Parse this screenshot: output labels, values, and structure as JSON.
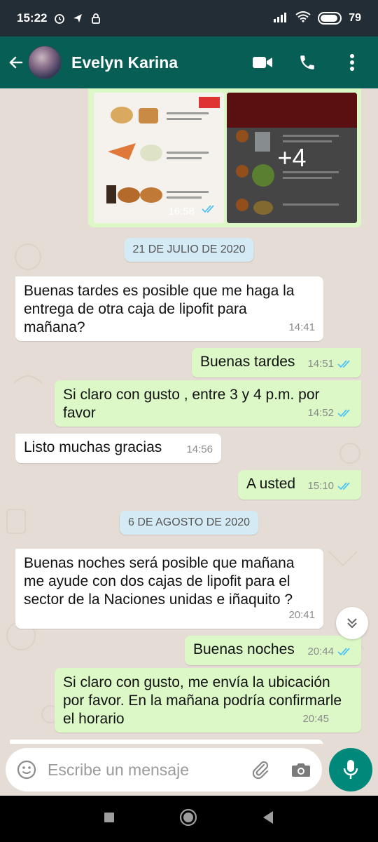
{
  "status_bar": {
    "time": "15:22",
    "battery": "79"
  },
  "header": {
    "contact_name": "Evelyn Karina"
  },
  "media": {
    "time": "16:58",
    "more_count": "+4"
  },
  "messages": [
    {
      "type": "date",
      "text": "21 DE JULIO DE 2020"
    },
    {
      "type": "in",
      "text": "Buenas tardes es posible que me haga la entrega de otra caja de lipofit para mañana?",
      "time": "14:41"
    },
    {
      "type": "out",
      "text": "Buenas tardes",
      "time": "14:51"
    },
    {
      "type": "out",
      "text": "Si claro con gusto , entre 3 y 4 p.m. por favor",
      "time": "14:52"
    },
    {
      "type": "in",
      "text": "Listo muchas gracias",
      "time": "14:56"
    },
    {
      "type": "out",
      "text": "A usted",
      "time": "15:10"
    },
    {
      "type": "date",
      "text": "6 DE AGOSTO DE 2020"
    },
    {
      "type": "in",
      "text": "Buenas noches será posible que mañana me ayude con dos cajas de lipofit para el sector de la Naciones unidas e iñaquito ?",
      "time": "20:41"
    },
    {
      "type": "out",
      "text": "Buenas noches",
      "time": "20:44"
    },
    {
      "type": "out",
      "text": "Si claro con gusto, me envía la ubicación por favor. En la mañana podría confirmarle el horario",
      "time": "20:45"
    }
  ],
  "composer": {
    "placeholder": "Escribe un mensaje"
  },
  "colors": {
    "header": "#075e54",
    "outgoing": "#dcf8c6",
    "incoming": "#ffffff",
    "date_chip": "#d4eaf4",
    "read_ticks": "#4fc3f7",
    "mic_button": "#00897b"
  }
}
